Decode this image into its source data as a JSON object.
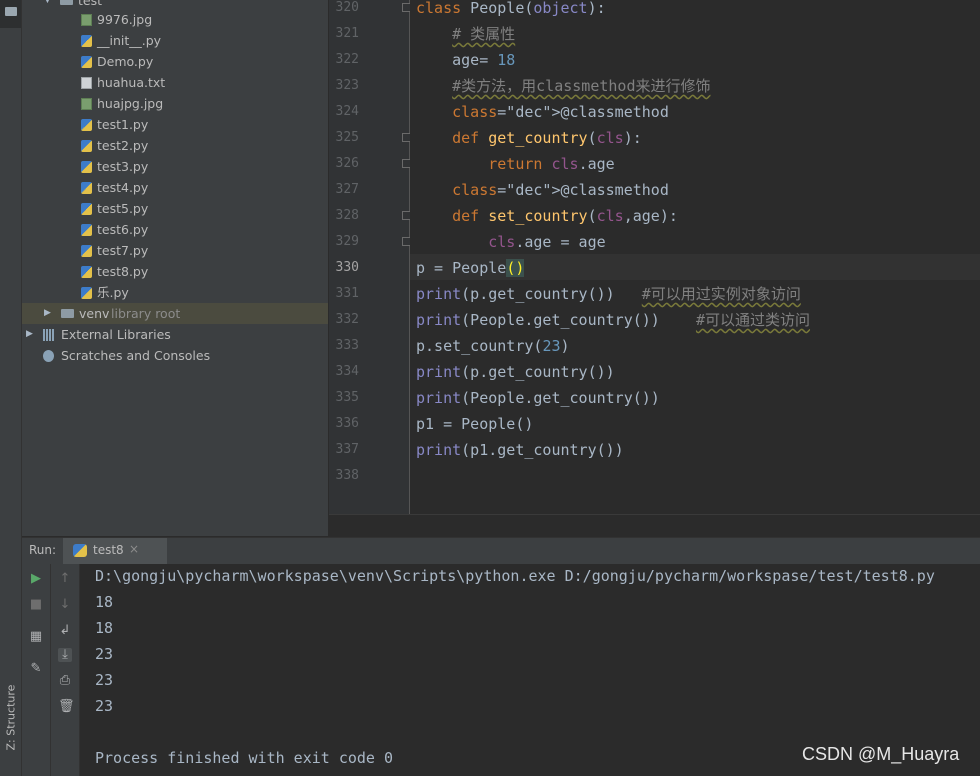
{
  "project_tree": {
    "root_label": "test",
    "files": [
      {
        "name": "9976.jpg",
        "icon": "image-file-icon"
      },
      {
        "name": "__init__.py",
        "icon": "python-file-icon"
      },
      {
        "name": "Demo.py",
        "icon": "python-file-icon"
      },
      {
        "name": "huahua.txt",
        "icon": "text-file-icon"
      },
      {
        "name": "huajpg.jpg",
        "icon": "image-file-icon"
      },
      {
        "name": "test1.py",
        "icon": "python-file-icon"
      },
      {
        "name": "test2.py",
        "icon": "python-file-icon"
      },
      {
        "name": "test3.py",
        "icon": "python-file-icon"
      },
      {
        "name": "test4.py",
        "icon": "python-file-icon"
      },
      {
        "name": "test5.py",
        "icon": "python-file-icon"
      },
      {
        "name": "test6.py",
        "icon": "python-file-icon"
      },
      {
        "name": "test7.py",
        "icon": "python-file-icon"
      },
      {
        "name": "test8.py",
        "icon": "python-file-icon"
      },
      {
        "name": "乐.py",
        "icon": "python-file-icon"
      }
    ],
    "venv": {
      "name": "venv",
      "suffix": "library root"
    },
    "external_libraries": "External Libraries",
    "scratches": "Scratches and Consoles"
  },
  "editor": {
    "current_line": 330,
    "lines": [
      {
        "n": "320",
        "code": "class People(object):"
      },
      {
        "n": "321",
        "code": "    # 类属性"
      },
      {
        "n": "322",
        "code": "    age= 18"
      },
      {
        "n": "323",
        "code": "    #类方法，用classmethod来进行修饰"
      },
      {
        "n": "324",
        "code": "    @classmethod"
      },
      {
        "n": "325",
        "code": "    def get_country(cls):"
      },
      {
        "n": "326",
        "code": "        return cls.age"
      },
      {
        "n": "327",
        "code": "    @classmethod"
      },
      {
        "n": "328",
        "code": "    def set_country(cls,age):"
      },
      {
        "n": "329",
        "code": "        cls.age = age"
      },
      {
        "n": "330",
        "code": "p = People()"
      },
      {
        "n": "331",
        "code": "print(p.get_country())   #可以用过实例对象访问"
      },
      {
        "n": "332",
        "code": "print(People.get_country())    #可以通过类访问"
      },
      {
        "n": "333",
        "code": "p.set_country(23)"
      },
      {
        "n": "334",
        "code": "print(p.get_country())"
      },
      {
        "n": "335",
        "code": "print(People.get_country())"
      },
      {
        "n": "336",
        "code": "p1 = People()"
      },
      {
        "n": "337",
        "code": "print(p1.get_country())"
      },
      {
        "n": "338",
        "code": ""
      }
    ]
  },
  "run_panel": {
    "label": "Run:",
    "tab_name": "test8",
    "tab_close": "×",
    "output": [
      "D:\\gongju\\pycharm\\workspase\\venv\\Scripts\\python.exe D:/gongju/pycharm/workspase/test/test8.py",
      "18",
      "18",
      "23",
      "23",
      "23",
      "",
      "Process finished with exit code 0"
    ]
  },
  "side_tabs": {
    "structure": "Z: Structure"
  },
  "watermark": "CSDN @M_Huayra",
  "colors": {
    "editor_bg": "#2b2b2b",
    "panel_bg": "#3c3f41",
    "keyword": "#cc7832",
    "function": "#ffc66d",
    "number": "#6897bb",
    "comment": "#808080",
    "decorator": "#bbb529"
  }
}
